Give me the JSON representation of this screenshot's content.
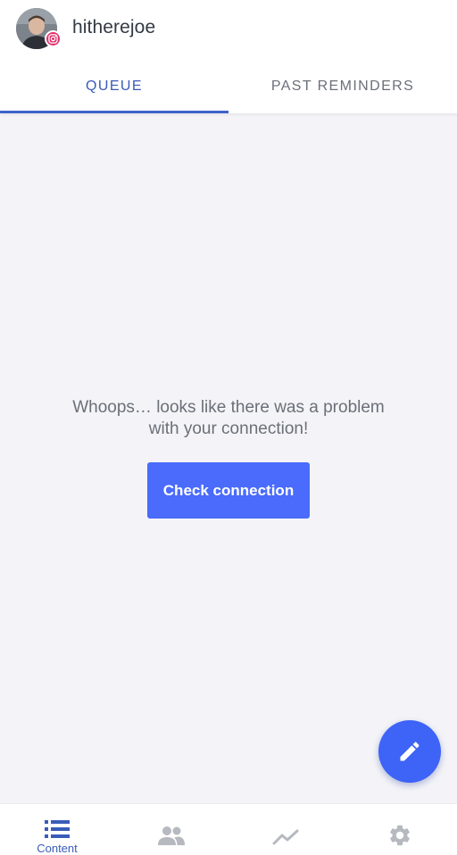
{
  "header": {
    "username": "hitherejoe"
  },
  "tabs": [
    {
      "label": "QUEUE",
      "active": true
    },
    {
      "label": "PAST REMINDERS",
      "active": false
    }
  ],
  "main": {
    "error_line1": "Whoops… looks like there was a problem",
    "error_line2": "with your connection!",
    "check_button_label": "Check connection"
  },
  "bottom_nav": {
    "items": [
      {
        "label": "Content",
        "icon": "list-icon",
        "active": true
      },
      {
        "label": "",
        "icon": "people-icon",
        "active": false
      },
      {
        "label": "",
        "icon": "trending-icon",
        "active": false
      },
      {
        "label": "",
        "icon": "settings-gear-icon",
        "active": false
      }
    ]
  },
  "colors": {
    "accent": "#3a5bb8",
    "button": "#4a6bfb",
    "fab": "#3d63f7",
    "instagram_badge": "#e1306c",
    "background": "#f4f4f8",
    "inactive_icon": "#b6b9bf"
  },
  "fab": {
    "icon": "pencil-edit-icon"
  }
}
